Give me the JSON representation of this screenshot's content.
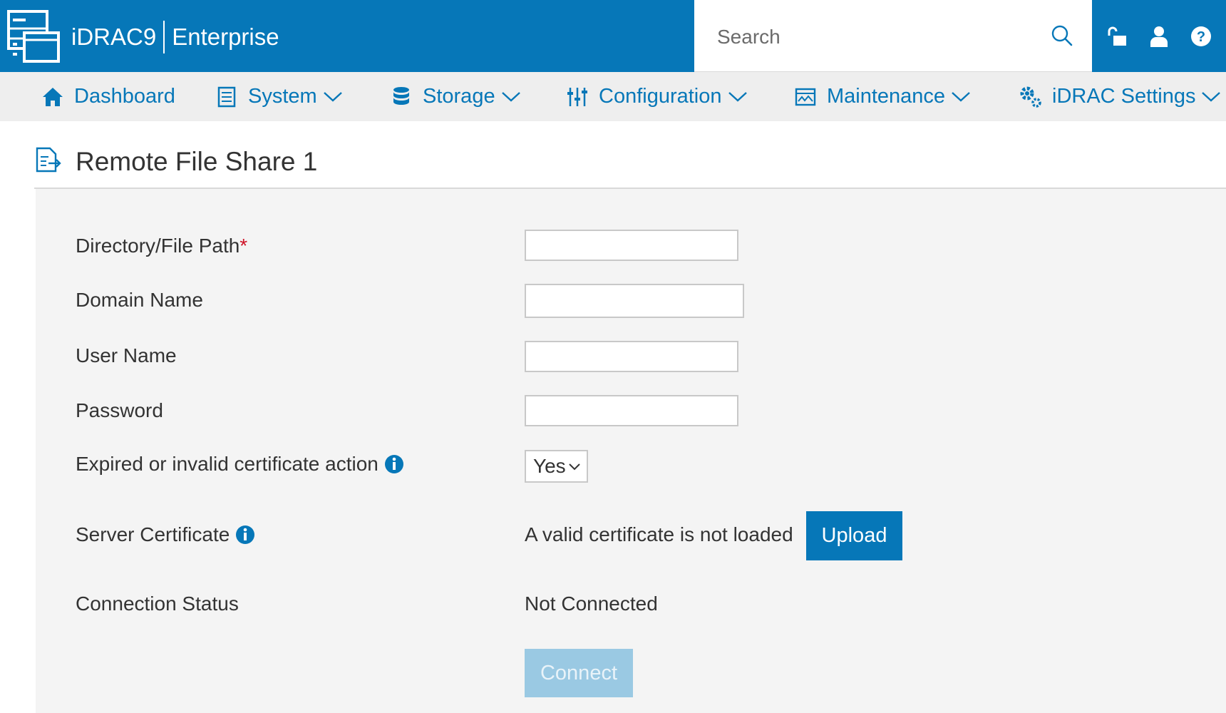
{
  "header": {
    "product": "iDRAC9",
    "edition": "Enterprise",
    "search_placeholder": "Search",
    "brand_color": "#0677b8"
  },
  "nav": {
    "items": [
      {
        "label": "Dashboard",
        "icon": "home-icon",
        "has_menu": false
      },
      {
        "label": "System",
        "icon": "server-icon",
        "has_menu": true
      },
      {
        "label": "Storage",
        "icon": "database-icon",
        "has_menu": true
      },
      {
        "label": "Configuration",
        "icon": "sliders-icon",
        "has_menu": true
      },
      {
        "label": "Maintenance",
        "icon": "monitor-chart-icon",
        "has_menu": true
      },
      {
        "label": "iDRAC Settings",
        "icon": "gears-icon",
        "has_menu": true
      }
    ]
  },
  "page": {
    "title": "Remote File Share 1"
  },
  "form": {
    "path_label": "Directory/File Path",
    "required_mark": "*",
    "path_value": "",
    "domain_label": "Domain Name",
    "domain_value": "",
    "user_label": "User Name",
    "user_value": "",
    "password_label": "Password",
    "password_value": "",
    "cert_action_label": "Expired or invalid certificate action",
    "cert_action_value": "Yes",
    "server_cert_label": "Server Certificate",
    "server_cert_status": "A valid certificate is not loaded",
    "upload_label": "Upload",
    "conn_status_label": "Connection Status",
    "conn_status_value": "Not Connected",
    "connect_label": "Connect"
  }
}
